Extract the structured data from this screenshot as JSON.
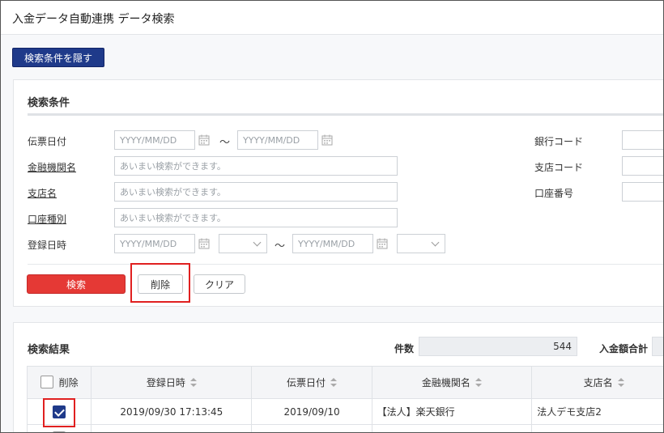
{
  "page": {
    "title": "入金データ自動連携 データ検索"
  },
  "toggle_button": "検索条件を隠す",
  "conditions": {
    "title": "検索条件",
    "voucher_date": {
      "label": "伝票日付",
      "from_placeholder": "YYYY/MM/DD",
      "to_placeholder": "YYYY/MM/DD"
    },
    "bank_name": {
      "label": "金融機関名",
      "placeholder": "あいまい検索ができます。"
    },
    "branch_name": {
      "label": "支店名",
      "placeholder": "あいまい検索ができます。"
    },
    "account_type": {
      "label": "口座種別",
      "placeholder": "あいまい検索ができます。"
    },
    "registered_at": {
      "label": "登録日時",
      "from_placeholder": "YYYY/MM/DD",
      "to_placeholder": "YYYY/MM/DD"
    },
    "bank_code": {
      "label": "銀行コード"
    },
    "branch_code": {
      "label": "支店コード"
    },
    "account_number": {
      "label": "口座番号"
    },
    "tilde": "～",
    "buttons": {
      "search": "検索",
      "delete": "削除",
      "clear": "クリア"
    }
  },
  "results": {
    "title": "検索結果",
    "count_label": "件数",
    "count_value": "544",
    "total_label": "入金額合計",
    "columns": [
      "削除",
      "登録日時",
      "伝票日付",
      "金融機関名",
      "支店名"
    ],
    "rows": [
      {
        "checked": true,
        "registered_at": "2019/09/30 17:13:45",
        "voucher_date": "2019/09/10",
        "bank_name": "【法人】楽天銀行",
        "branch_name": "法人デモ支店2"
      }
    ]
  },
  "colors": {
    "primary": "#1f3a8a",
    "danger": "#e53935",
    "highlight": "#e02020"
  }
}
